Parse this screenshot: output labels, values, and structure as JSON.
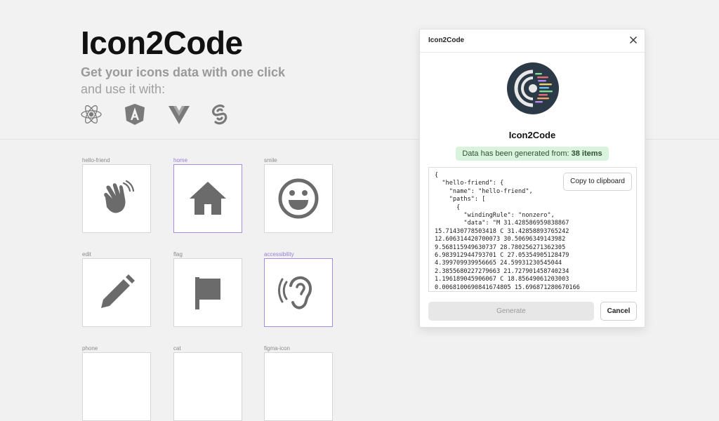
{
  "hero": {
    "title": "Icon2Code",
    "subtitle_bold": "Get your icons data with one click",
    "subtitle": "and use it with:",
    "frameworks": [
      "react-icon",
      "angular-icon",
      "vue-icon",
      "svelte-icon"
    ]
  },
  "icons": [
    {
      "name": "hello-friend",
      "selected": false
    },
    {
      "name": "home",
      "selected": true
    },
    {
      "name": "smile",
      "selected": false
    },
    {
      "name": "edit",
      "selected": false
    },
    {
      "name": "flag",
      "selected": false
    },
    {
      "name": "accessibility",
      "selected": true
    },
    {
      "name": "phone",
      "selected": false
    },
    {
      "name": "cat",
      "selected": false
    },
    {
      "name": "figma-icon",
      "selected": false
    }
  ],
  "modal": {
    "title": "Icon2Code",
    "app_name": "Icon2Code",
    "badge_prefix": "Data has been generated from: ",
    "badge_count": "38 items",
    "code": "{\n  \"hello-friend\": {\n    \"name\": \"hello-friend\",\n    \"paths\": [\n      {\n        \"windingRule\": \"nonzero\",\n        \"data\": \"M 31.428586959838867\n15.71430778503418 C 31.42858893765242\n12.606314420700073 30.50696349143982\n9.568115949630737 28.780256271362305\n6.983912944793701 C 27.05354905128479\n4.399709939956665 24.59931230545044\n2.3855680227279663 21.727901458740234\n1.196189045906067 C 18.85649061203003\n0.0068100690841674805 15.696871280670166",
    "copy_label": "Copy to clipboard",
    "generate_label": "Generate",
    "cancel_label": "Cancel"
  },
  "colors": {
    "icon_fill": "#6b6b6b",
    "selected_border": "#a98be0",
    "badge_bg": "#d9f3dd",
    "logo_bg": "#2c3a48"
  }
}
